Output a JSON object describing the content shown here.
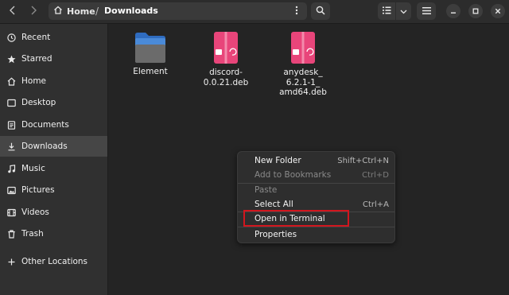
{
  "header": {
    "path_home": "Home",
    "path_separator": "/",
    "path_current": "Downloads"
  },
  "sidebar": {
    "items": [
      {
        "label": "Recent",
        "icon": "clock-icon"
      },
      {
        "label": "Starred",
        "icon": "star-icon"
      },
      {
        "label": "Home",
        "icon": "home-icon"
      },
      {
        "label": "Desktop",
        "icon": "desktop-icon"
      },
      {
        "label": "Documents",
        "icon": "document-icon"
      },
      {
        "label": "Downloads",
        "icon": "download-icon"
      },
      {
        "label": "Music",
        "icon": "music-icon"
      },
      {
        "label": "Pictures",
        "icon": "picture-icon"
      },
      {
        "label": "Videos",
        "icon": "video-icon"
      },
      {
        "label": "Trash",
        "icon": "trash-icon"
      }
    ],
    "other_locations": "Other Locations",
    "active": "Downloads"
  },
  "files": [
    {
      "name": "Element",
      "type": "folder"
    },
    {
      "name": "discord-\n0.0.21.deb",
      "type": "deb"
    },
    {
      "name": "anydesk_\n6.2.1-1_\namd64.deb",
      "type": "deb"
    }
  ],
  "context_menu": {
    "items": [
      {
        "label": "New Folder",
        "accel": "Shift+Ctrl+N",
        "enabled": true
      },
      {
        "label": "Add to Bookmarks",
        "accel": "Ctrl+D",
        "enabled": false
      },
      {
        "label": "Paste",
        "accel": "",
        "enabled": false
      },
      {
        "label": "Select All",
        "accel": "Ctrl+A",
        "enabled": true
      },
      {
        "label": "Open in Terminal",
        "accel": "",
        "enabled": true,
        "highlighted": true
      },
      {
        "label": "Properties",
        "accel": "",
        "enabled": true
      }
    ]
  },
  "colors": {
    "folder": "#4a8ad8",
    "deb_package": "#e8457a",
    "highlight_box": "#d2161e"
  }
}
